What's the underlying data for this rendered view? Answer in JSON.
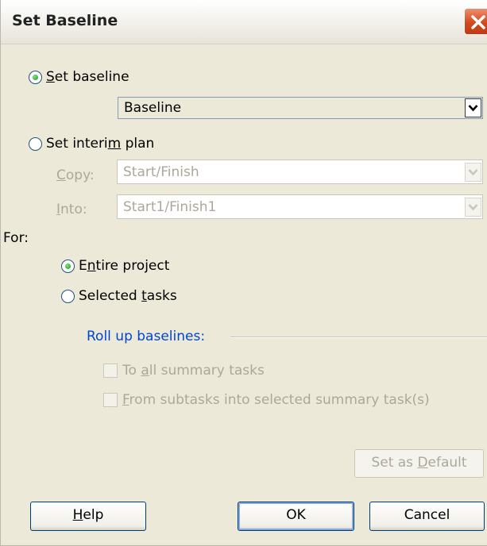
{
  "dialog": {
    "title": "Set Baseline"
  },
  "set_baseline": {
    "radio_label": "Set baseline",
    "radio_checked": true,
    "dropdown_value": "Baseline"
  },
  "set_interim_plan": {
    "radio_label": "Set interim plan",
    "radio_checked": false,
    "copy_label": "Copy:",
    "copy_value": "Start/Finish",
    "into_label": "Into:",
    "into_value": "Start1/Finish1"
  },
  "for_section": {
    "label": "For:",
    "entire_project_label": "Entire project",
    "entire_project_checked": true,
    "selected_tasks_label": "Selected tasks",
    "selected_tasks_checked": false
  },
  "roll_up": {
    "heading": "Roll up baselines:",
    "heading_color": "#0046d5",
    "to_all_summary_label": "To all summary tasks",
    "from_subtasks_label": "From subtasks into selected summary task(s)"
  },
  "buttons": {
    "set_as_default": "Set as Default",
    "help": "Help",
    "ok": "OK",
    "cancel": "Cancel"
  },
  "icons": {
    "close": "close-icon",
    "dropdown": "chevron-down-icon"
  }
}
